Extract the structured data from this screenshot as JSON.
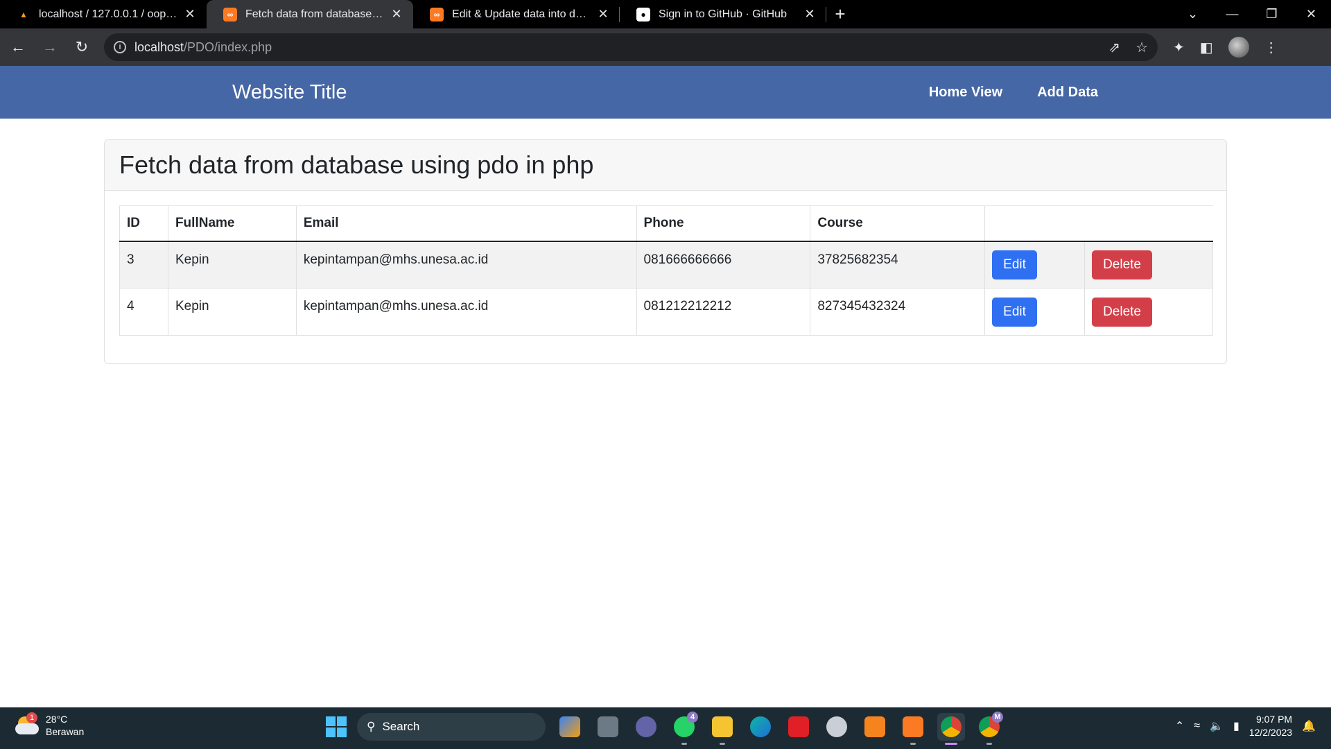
{
  "browser": {
    "tabs": [
      {
        "title": "localhost / 127.0.0.1 / oop / stud",
        "icon": "phpmyadmin-icon",
        "active": false
      },
      {
        "title": "Fetch data from database using",
        "icon": "xampp-icon",
        "active": true
      },
      {
        "title": "Edit & Update data into databas",
        "icon": "xampp-icon",
        "active": false
      },
      {
        "title": "Sign in to GitHub · GitHub",
        "icon": "github-icon",
        "active": false
      }
    ],
    "url_host": "localhost",
    "url_path": "/PDO/index.php"
  },
  "navbar": {
    "brand": "Website Title",
    "links": [
      "Home View",
      "Add Data"
    ]
  },
  "card": {
    "title": "Fetch data from database using pdo in php"
  },
  "table": {
    "headers": [
      "ID",
      "FullName",
      "Email",
      "Phone",
      "Course"
    ],
    "rows": [
      {
        "id": "3",
        "fullname": "Kepin",
        "email": "kepintampan@mhs.unesa.ac.id",
        "phone": "081666666666",
        "course": "37825682354",
        "edit": "Edit",
        "delete": "Delete"
      },
      {
        "id": "4",
        "fullname": "Kepin",
        "email": "kepintampan@mhs.unesa.ac.id",
        "phone": "081212212212",
        "course": "827345432324",
        "edit": "Edit",
        "delete": "Delete"
      }
    ]
  },
  "taskbar": {
    "weather_temp": "28°C",
    "weather_desc": "Berawan",
    "weather_badge": "1",
    "search_label": "Search",
    "whatsapp_badge": "4",
    "chrome_profile_badge": "M",
    "time": "9:07 PM",
    "date": "12/2/2023"
  },
  "colors": {
    "navbar": "#4667a5",
    "edit_button": "#2f6ff1",
    "delete_button": "#d33f49"
  }
}
